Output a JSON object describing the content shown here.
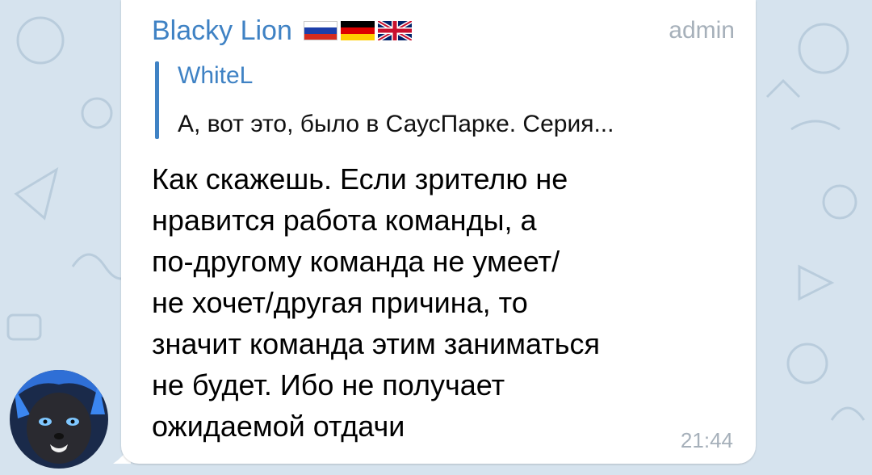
{
  "message": {
    "sender_name": "Blacky Lion",
    "sender_role": "admin",
    "flags": [
      "russia-flag-icon",
      "germany-flag-icon",
      "uk-flag-icon"
    ],
    "reply": {
      "author": "WhiteL",
      "text": "А, вот это, было в СаусПарке. Серия..."
    },
    "text_lines": [
      "Как скажешь. Если зрителю не",
      "нравится работа команды, а",
      "по-другому команда не умеет/",
      "не хочет/другая причина, то",
      "значит команда этим заниматься",
      "не будет. Ибо не получает",
      "ожидаемой отдачи"
    ],
    "time": "21:44"
  },
  "colors": {
    "accent": "#3f82c4",
    "meta_text": "#a6b0ba",
    "background": "#d6e3ee",
    "bubble": "#ffffff"
  }
}
